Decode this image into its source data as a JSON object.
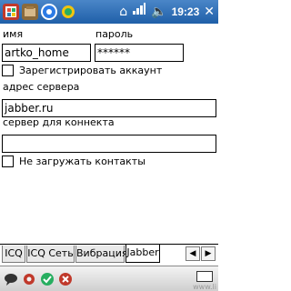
{
  "statusbar": {
    "time": "19:23"
  },
  "form": {
    "username_label": "имя",
    "password_label": "пароль",
    "username_value": "artko_home",
    "password_value": "******",
    "register_label": "Зарегистрировать аккаунт",
    "server_label": "адрес сервера",
    "server_value": "jabber.ru",
    "connect_server_label": "сервер для коннекта",
    "connect_server_value": "",
    "no_contacts_label": "Не загружать контакты"
  },
  "tabs": [
    {
      "label": "ICQ"
    },
    {
      "label": "ICQ Сеть"
    },
    {
      "label": "Вибрация"
    },
    {
      "label": "Jabber"
    }
  ],
  "footer": {
    "watermark": "www.li"
  },
  "colors": {
    "titlebar": "#1f5fa8",
    "active_tab": "#ffffff"
  }
}
